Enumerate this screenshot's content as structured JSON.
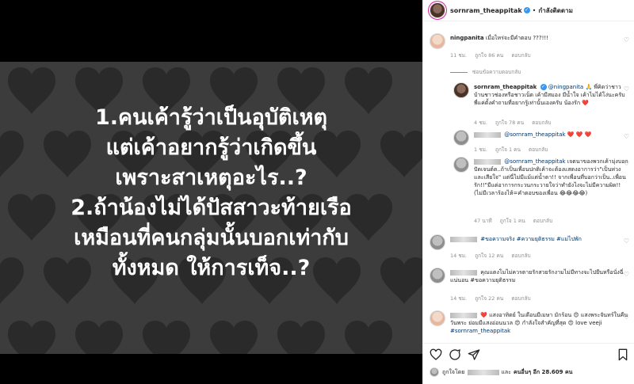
{
  "media": {
    "lines": [
      "1.คนเค้ารู้ว่าเป็นอุบัติเหตุ",
      "แต่เค้าอยากรู้ว่าเกิดขึ้น",
      "เพราะสาเหตุอะไร..?",
      "2.ถ้าน้องไม่ได้ปัสสาวะท้ายเรือ",
      "เหมือนที่คนกลุ่มนั้นบอกเท่ากับ",
      "ทั้งหมด ให้การเท็จ..?"
    ]
  },
  "header": {
    "username": "sornram_theappitak",
    "verified_mark": "✓",
    "separator": "•",
    "following": "กำลังติดตาม"
  },
  "comments": [
    {
      "username": "ningpanita",
      "text": "เมื่อไหร่จะมีคำตอบ ???!!!",
      "time": "11 ชม.",
      "likes": "ถูกใจ 86 คน",
      "reply": "ตอบกลับ"
    },
    {
      "hide_replies": "ซ่อนข้อความตอบกลับ"
    },
    {
      "username": "sornram_theappitak",
      "mention": "@ningpanita",
      "text": "🙏 พี่คิดว่าชาวบ้านชาวช่องหรือชาวเน็ต เค้ามีสมอง มีน้ำใจ เค้าไม่ได้โง่นะครับ พี่แค่ตั้งคำถามที่อยากรู้เท่านั้นเองครับ น้องรัก ❤️",
      "time": "4 ชม.",
      "likes": "ถูกใจ 78 คน",
      "reply": "ตอบกลับ"
    },
    {
      "mention": "@sornram_theappitak",
      "text": "❤️ ❤️ ❤️",
      "time": "1 ชม.",
      "likes": "ถูกใจ 1 คน",
      "reply": "ตอบกลับ"
    },
    {
      "mention": "@sornram_theappitak",
      "text": "เจตนาของพวกเค้ามุ่งบอกปัดเจนต์ต..ถ้าเป็นเพื่อนปกติเค้าจะต้องแสดงอาการว่า\"เป็นห่วงและเสียใจ\" แต่นี่ไม่มีแม้แต่น้ำตา!! จากเพื่อนที่บอกว่าเป็น..เพื่อนรัก!!\"มีแต่อาการกระวนกระวายใจว่าทำยังไงจะไม่มีความผิด!!(ไม่มีเวลาร้องไห้=คำตอบของเพื่อน 😂😂😂😂)",
      "time": "47 นาที",
      "likes": "ถูกใจ 1 คน",
      "reply": "ตอบกลับ"
    },
    {
      "text": "#ขอความจริง #ความยุติธรรม #แม่ไปพัก",
      "time": "14 ชม.",
      "likes": "ถูกใจ 12 คน",
      "reply": "ตอบกลับ"
    },
    {
      "text": "คุณแตงโมไม่ควรตายรักสวยรักงามไม่มีทางจะไปยืนหรือนั่งฉี่แน่นอน #ขอความยุติธรรม",
      "time": "14 ชม.",
      "likes": "ถูกใจ 22 คน",
      "reply": "ตอบกลับ"
    },
    {
      "text": "❤️ แสงอาทิตย์ ในเดือนมีเมษา มักร้อน 😍 แสงพระจันทร์ในคืนวันพระ ย่อมมีแสงอ่อนนวล 😍 กำลังใจสำคัญที่สุด 😍 love veeji",
      "tag": "#sornram_theappitak",
      "time": "",
      "likes": "",
      "reply": ""
    }
  ],
  "footer": {
    "liked_by_prefix": "ถูกใจโดย",
    "liked_by_and": "และ",
    "others": "คนอื่นๆ อีก 28.609 คน"
  },
  "icons": {
    "like": "heart-outline-icon",
    "comment": "comment-icon",
    "share": "paper-plane-icon",
    "save": "bookmark-icon"
  }
}
